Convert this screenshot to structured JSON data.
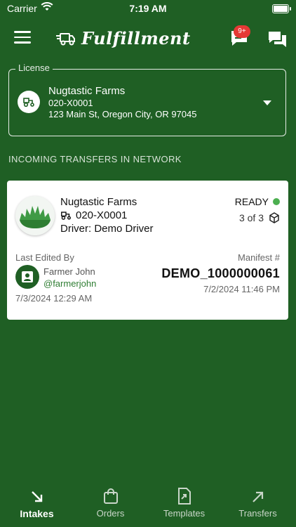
{
  "status_bar": {
    "carrier": "Carrier",
    "time": "7:19 AM"
  },
  "header": {
    "title": "Fulfillment",
    "notification_badge": "9+"
  },
  "license": {
    "legend": "License",
    "name": "Nugtastic Farms",
    "number": "020-X0001",
    "address": "123 Main St, Oregon City, OR 97045"
  },
  "section": {
    "title": "INCOMING TRANSFERS IN NETWORK"
  },
  "transfer": {
    "facility": "Nugtastic Farms",
    "license_number": "020-X0001",
    "driver": "Driver: Demo Driver",
    "status": "READY",
    "status_color": "#4caf50",
    "package_count": "3 of 3",
    "last_edited_label": "Last Edited By",
    "editor_name": "Farmer John",
    "editor_handle": "@farmerjohn",
    "edited_at": "7/3/2024 12:29 AM",
    "manifest_label": "Manifest #",
    "manifest_number": "DEMO_1000000061",
    "manifest_at": "7/2/2024 11:46 PM"
  },
  "tabs": [
    {
      "label": "Intakes",
      "icon": "arrow-down-right-icon",
      "active": true
    },
    {
      "label": "Orders",
      "icon": "shopping-bag-icon",
      "active": false
    },
    {
      "label": "Templates",
      "icon": "document-icon",
      "active": false
    },
    {
      "label": "Transfers",
      "icon": "arrow-up-right-icon",
      "active": false
    }
  ],
  "colors": {
    "background": "#1f5f24",
    "accent": "#2e7d32",
    "badge": "#e53935"
  }
}
